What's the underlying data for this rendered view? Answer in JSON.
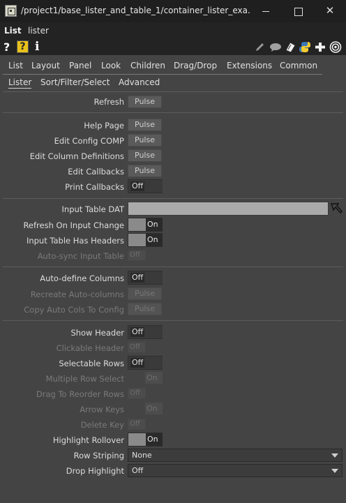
{
  "window": {
    "title": "/project1/base_lister_and_table_1/container_lister_exa...",
    "minimize_glyph": "",
    "maximize_glyph": "",
    "close_glyph": "✕"
  },
  "operator": {
    "type": "List",
    "name": "lister"
  },
  "toolbar": {
    "question_glyph": "?",
    "help_glyph": "?",
    "info_glyph": "i",
    "icons": [
      "pencil-icon",
      "comment-icon",
      "clone-icon",
      "python-icon",
      "plus-icon",
      "target-icon"
    ]
  },
  "page_tabs": [
    "List",
    "Layout",
    "Panel",
    "Look",
    "Children",
    "Drag/Drop",
    "Extensions",
    "Common"
  ],
  "sub_tabs": [
    "Lister",
    "Sort/Filter/Select",
    "Advanced"
  ],
  "params": {
    "refresh": {
      "label": "Refresh",
      "value": "Pulse"
    },
    "help_page": {
      "label": "Help Page",
      "value": "Pulse"
    },
    "edit_config_comp": {
      "label": "Edit Config COMP",
      "value": "Pulse"
    },
    "edit_column_definitions": {
      "label": "Edit Column Definitions",
      "value": "Pulse"
    },
    "edit_callbacks": {
      "label": "Edit Callbacks",
      "value": "Pulse"
    },
    "print_callbacks": {
      "label": "Print Callbacks",
      "value": "Off"
    },
    "input_table_dat": {
      "label": "Input Table DAT",
      "value": ""
    },
    "refresh_on_input_change": {
      "label": "Refresh On Input Change",
      "value": "On"
    },
    "input_table_has_headers": {
      "label": "Input Table Has Headers",
      "value": "On"
    },
    "auto_sync_input_table": {
      "label": "Auto-sync Input Table",
      "value": "Off"
    },
    "auto_define_columns": {
      "label": "Auto-define Columns",
      "value": "Off"
    },
    "recreate_auto_columns": {
      "label": "Recreate Auto-columns",
      "value": "Pulse"
    },
    "copy_auto_cols_to_config": {
      "label": "Copy Auto Cols To Config",
      "value": "Pulse"
    },
    "show_header": {
      "label": "Show Header",
      "value": "Off"
    },
    "clickable_header": {
      "label": "Clickable Header",
      "value": "Off"
    },
    "selectable_rows": {
      "label": "Selectable Rows",
      "value": "Off"
    },
    "multiple_row_select": {
      "label": "Multiple Row Select",
      "value": "On"
    },
    "drag_to_reorder_rows": {
      "label": "Drag To Reorder Rows",
      "value": "Off"
    },
    "arrow_keys": {
      "label": "Arrow Keys",
      "value": "On"
    },
    "delete_key": {
      "label": "Delete Key",
      "value": "Off"
    },
    "highlight_rollover": {
      "label": "Highlight Rollover",
      "value": "On"
    },
    "row_striping": {
      "label": "Row Striping",
      "value": "None"
    },
    "drop_highlight": {
      "label": "Drop Highlight",
      "value": "Off"
    }
  }
}
